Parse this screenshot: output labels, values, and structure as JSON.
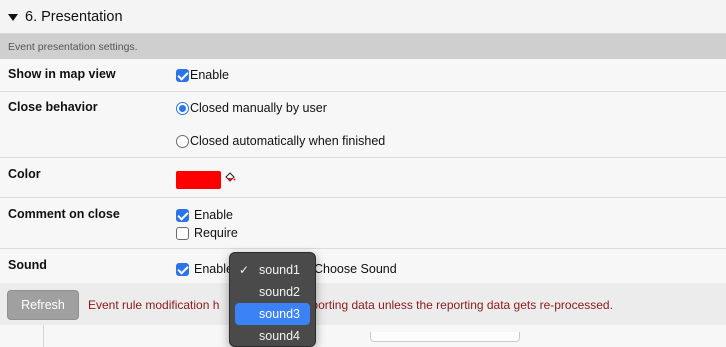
{
  "section": {
    "title": "6. Presentation",
    "description": "Event presentation settings."
  },
  "rows": {
    "map_view": {
      "label": "Show in map view",
      "option": "Enable",
      "checked": true
    },
    "close_behavior": {
      "label": "Close behavior",
      "options": [
        {
          "label": "Closed manually by user",
          "selected": true
        },
        {
          "label": "Closed automatically when finished",
          "selected": false
        }
      ]
    },
    "color": {
      "label": "Color",
      "value": "#ff0000",
      "icon": "paint-bucket-icon"
    },
    "comment_on_close": {
      "label": "Comment on close",
      "enable": {
        "label": "Enable",
        "checked": true
      },
      "require": {
        "label": "Require",
        "checked": false
      }
    },
    "sound": {
      "label": "Sound",
      "enable": {
        "label": "Enable",
        "checked": true
      },
      "choose_label": "Choose Sound"
    }
  },
  "footer": {
    "refresh_label": "Refresh",
    "warning_prefix": "Event rule modification h",
    "warning_suffix": "old reporting data unless the reporting data gets re-processed."
  },
  "sound_dropdown": {
    "items": [
      "sound1",
      "sound2",
      "sound3",
      "sound4"
    ],
    "checked": "sound1",
    "highlighted": "sound3",
    "check_glyph": "✓"
  },
  "colors": {
    "accent": "#2a73e8",
    "warning": "#8b1a1a",
    "highlight": "#3b82f6"
  }
}
